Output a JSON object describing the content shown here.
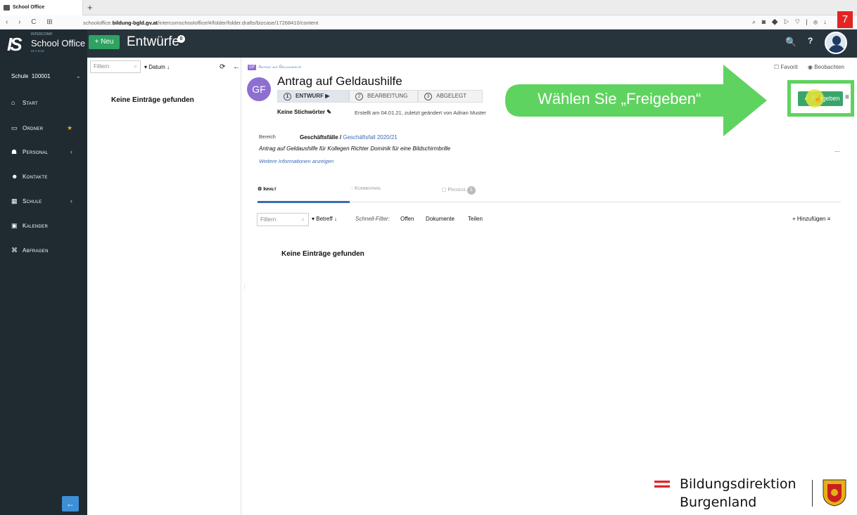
{
  "browser": {
    "tab_title": "School Office",
    "new_tab": "+",
    "nav": "‹ › C ⊞",
    "url_prefix": "schooloffice.",
    "url_host": "bildung-bgld.gv.at",
    "url_path": "/intercomschooloffice/#/folder/folder.drafts/bizcase/17268410/content",
    "extensions": "⌕ ◙ ◆ ▷ ♡ | ⊕ ↓",
    "step_badge": "7"
  },
  "header": {
    "logo_mark": "IS",
    "logo_intercom": "INTERCOM®",
    "logo_name": "School Office",
    "logo_version": "v1.7.4.12",
    "new_button": "+ Neu",
    "title": "Entwürfe",
    "title_badge": "0",
    "search_icon": "🔍",
    "help_icon": "?"
  },
  "sidebar": {
    "schule_label": "Schule",
    "schule_value": "100001",
    "items": [
      {
        "icon": "house-icon",
        "glyph": "⌂",
        "label": "Start"
      },
      {
        "icon": "folder-icon",
        "glyph": "▭",
        "label": "Ordner",
        "star": "★"
      },
      {
        "icon": "graduation-icon",
        "glyph": "☗",
        "label": "Personal",
        "chevron": "‹"
      },
      {
        "icon": "users-icon",
        "glyph": "☻",
        "label": "Kontakte"
      },
      {
        "icon": "building-icon",
        "glyph": "▦",
        "label": "Schule",
        "chevron": "‹"
      },
      {
        "icon": "calendar-icon",
        "glyph": "▣",
        "label": "Kalender"
      },
      {
        "icon": "binoculars-icon",
        "glyph": "⌘",
        "label": "Abfragen"
      }
    ],
    "collapse": "←"
  },
  "list": {
    "filter_placeholder": "Filtern",
    "sort_label": "▾ Datum ↓",
    "actions": "⟳ ←",
    "empty": "Keine Einträge gefunden"
  },
  "detail": {
    "crumb_tag": "GF",
    "crumb": "Antrag auf Geldaushilfe",
    "favorite": "☐ Favorit",
    "observe": "◉ Beobachten",
    "avatar": "GF",
    "title": "Antrag auf Geldaushilfe",
    "steps": [
      {
        "num": "1",
        "label": "ENTWURF ▶"
      },
      {
        "num": "2",
        "label": "BEARBEITUNG"
      },
      {
        "num": "3",
        "label": "ABGELEGT"
      }
    ],
    "keywords": "Keine Stichwörter ✎",
    "created": "Erstellt am 04.01.21, zuletzt geändert von Adrian Muster",
    "bereich_label": "Bereich",
    "bereich_value": "Geschäftsfälle / ",
    "bereich_link": "Geschäftsfall 2020/21",
    "description": "Antrag auf Geldaushilfe für Kollegen Richter Dominik für eine Bildschirmbrille",
    "more_info": "Weitere Informationen anzeigen",
    "dots": "...",
    "tabs": {
      "inhalt": "⚙ Inhalt",
      "kommentare": "◌ Kommentare",
      "prozess": "▢ Prozess",
      "prozess_count": "1"
    },
    "filter_placeholder": "Filtern",
    "betreff": "▾ Betreff ↓",
    "schnell_label": "Schnell-Filter:",
    "schnell_offen": "Offen",
    "schnell_dokumente": "Dokumente",
    "schnell_teilen": "Teilen",
    "add": "+ Hinzufügen ≡",
    "empty": "Keine Einträge gefunden",
    "release_button": "✔ Freigeben",
    "menu_icon": "≡"
  },
  "callout": {
    "text": "Wählen Sie „Freigeben“",
    "color": "#5fd35f"
  },
  "footer": {
    "brand_line1": "Bildungsdirektion",
    "brand_line2": "Burgenland"
  }
}
